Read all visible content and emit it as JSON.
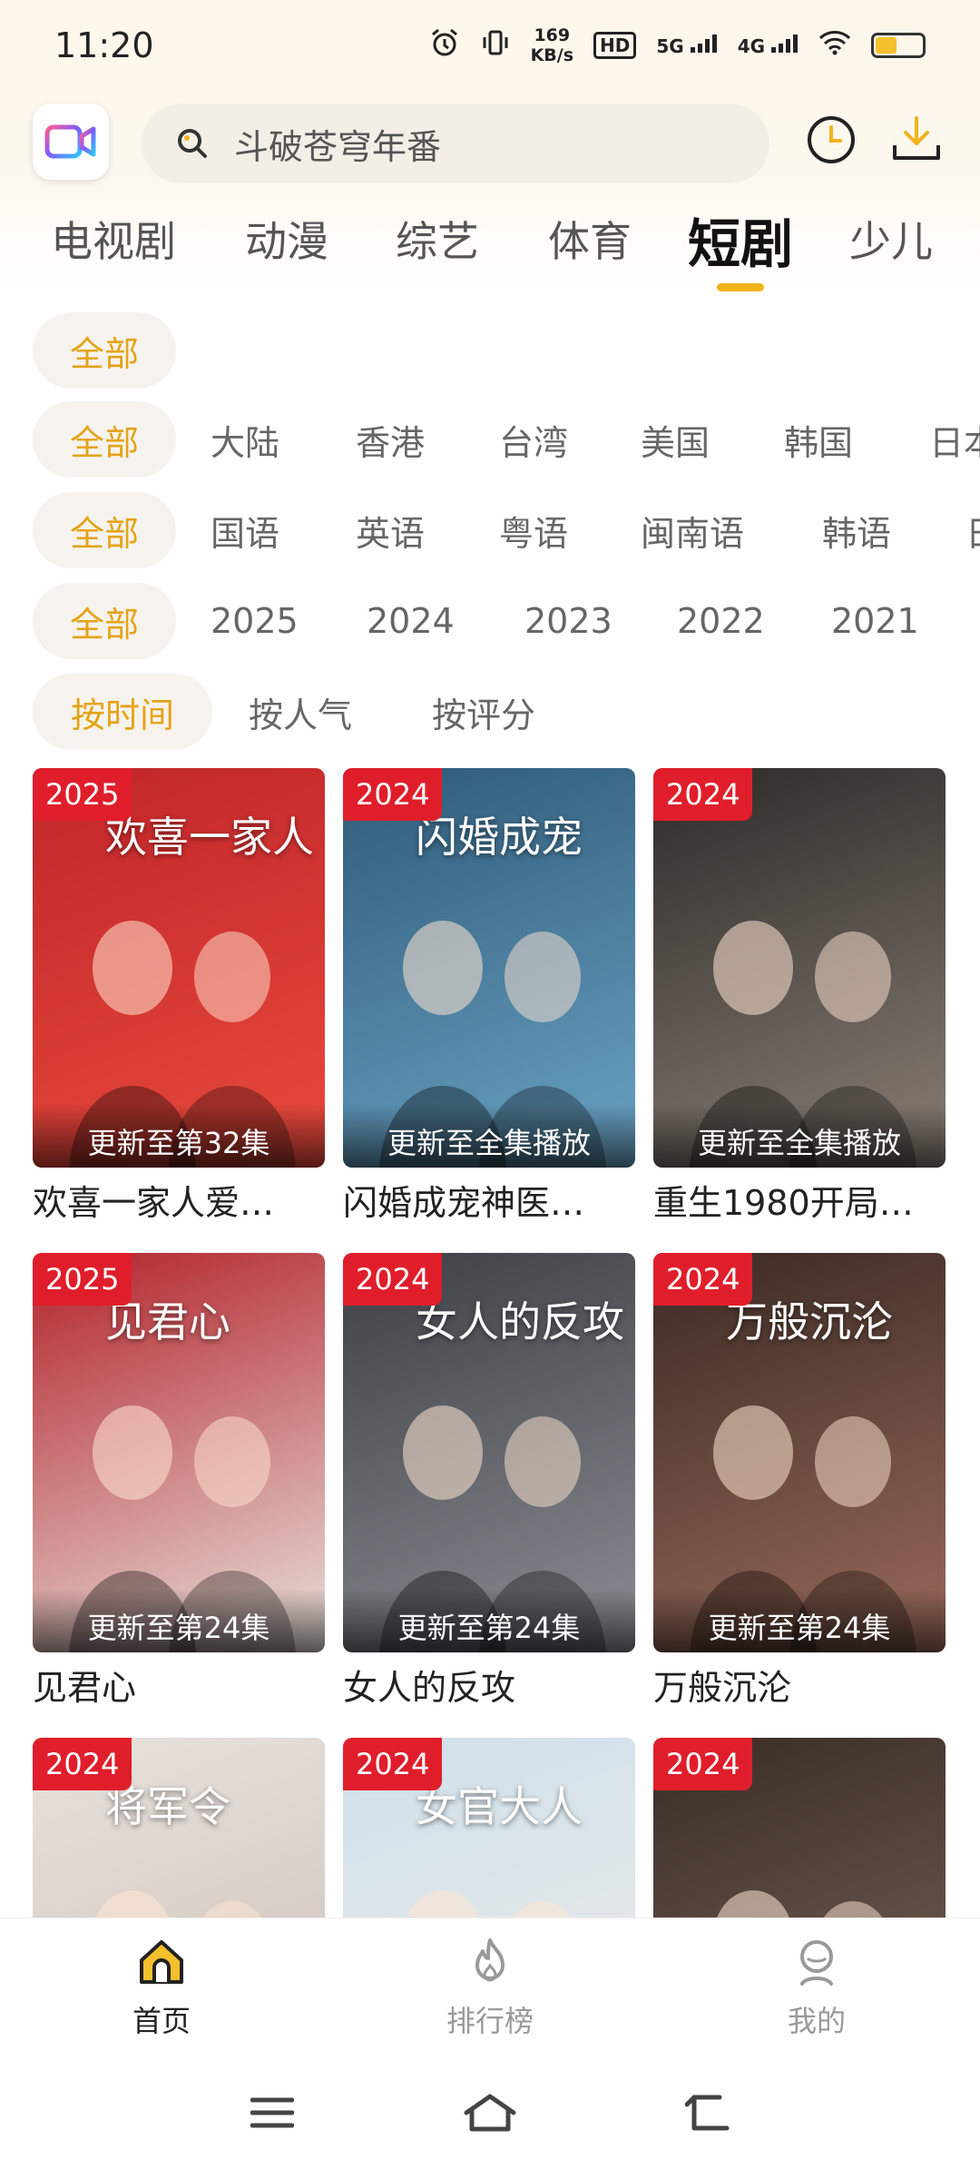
{
  "status_bar": {
    "time": "11:20",
    "speed_value": "169",
    "speed_unit": "KB/s",
    "hd_label": "HD",
    "net1": "5G",
    "net2": "4G",
    "battery_level": 0.45
  },
  "header": {
    "search_placeholder": "斗破苍穹年番",
    "logo_icon": "video-camera-icon",
    "history_icon": "clock-icon",
    "download_icon": "download-icon"
  },
  "tabs": [
    {
      "label": "电视剧"
    },
    {
      "label": "动漫"
    },
    {
      "label": "综艺"
    },
    {
      "label": "体育"
    },
    {
      "label": "短剧",
      "active": true
    },
    {
      "label": "少儿"
    }
  ],
  "filters": {
    "type": {
      "all": "全部"
    },
    "region": {
      "all": "全部",
      "options": [
        "大陆",
        "香港",
        "台湾",
        "美国",
        "韩国",
        "日本"
      ]
    },
    "language": {
      "all": "全部",
      "options": [
        "国语",
        "英语",
        "粤语",
        "闽南语",
        "韩语",
        "日"
      ]
    },
    "year": {
      "all": "全部",
      "options": [
        "2025",
        "2024",
        "2023",
        "2022",
        "2021"
      ]
    },
    "sort": {
      "active": "按时间",
      "options": [
        "按人气",
        "按评分"
      ]
    }
  },
  "cards": [
    {
      "year": "2025",
      "episode": "更新至第32集",
      "title": "欢喜一家人爱…",
      "art": "欢喜一家人",
      "colors": [
        "#c0252a",
        "#e84a3c"
      ]
    },
    {
      "year": "2024",
      "episode": "更新至全集播放",
      "title": "闪婚成宠神医…",
      "art": "闪婚成宠",
      "colors": [
        "#2f5a78",
        "#6aa3c4"
      ]
    },
    {
      "year": "2024",
      "episode": "更新至全集播放",
      "title": "重生1980开局…",
      "art": "",
      "colors": [
        "#2d2a28",
        "#8a7f76"
      ]
    },
    {
      "year": "2025",
      "episode": "更新至第24集",
      "title": "见君心",
      "art": "见君心",
      "colors": [
        "#b3232b",
        "#e8e2dc"
      ]
    },
    {
      "year": "2024",
      "episode": "更新至第24集",
      "title": "女人的反攻",
      "art": "女人的反攻",
      "colors": [
        "#3c3f44",
        "#8b8e94"
      ]
    },
    {
      "year": "2024",
      "episode": "更新至第24集",
      "title": "万般沉沦",
      "art": "万般沉沦",
      "colors": [
        "#3a2a24",
        "#9a6a5a"
      ]
    },
    {
      "year": "2024",
      "episode": "",
      "title": "",
      "art": "将军令",
      "colors": [
        "#e9e2dc",
        "#c9beb6"
      ]
    },
    {
      "year": "2024",
      "episode": "",
      "title": "",
      "art": "女官大人",
      "colors": [
        "#cfe0ec",
        "#f0ece6"
      ]
    },
    {
      "year": "2024",
      "episode": "",
      "title": "",
      "art": "",
      "colors": [
        "#3a2c26",
        "#7d6a5e"
      ]
    }
  ],
  "bottom_nav": [
    {
      "label": "首页",
      "icon": "home-icon",
      "active": true
    },
    {
      "label": "排行榜",
      "icon": "fire-icon"
    },
    {
      "label": "我的",
      "icon": "profile-icon"
    }
  ],
  "colors": {
    "accent": "#f2b31a",
    "badge": "#e01e2b",
    "chip_active_text": "#e5a316"
  }
}
